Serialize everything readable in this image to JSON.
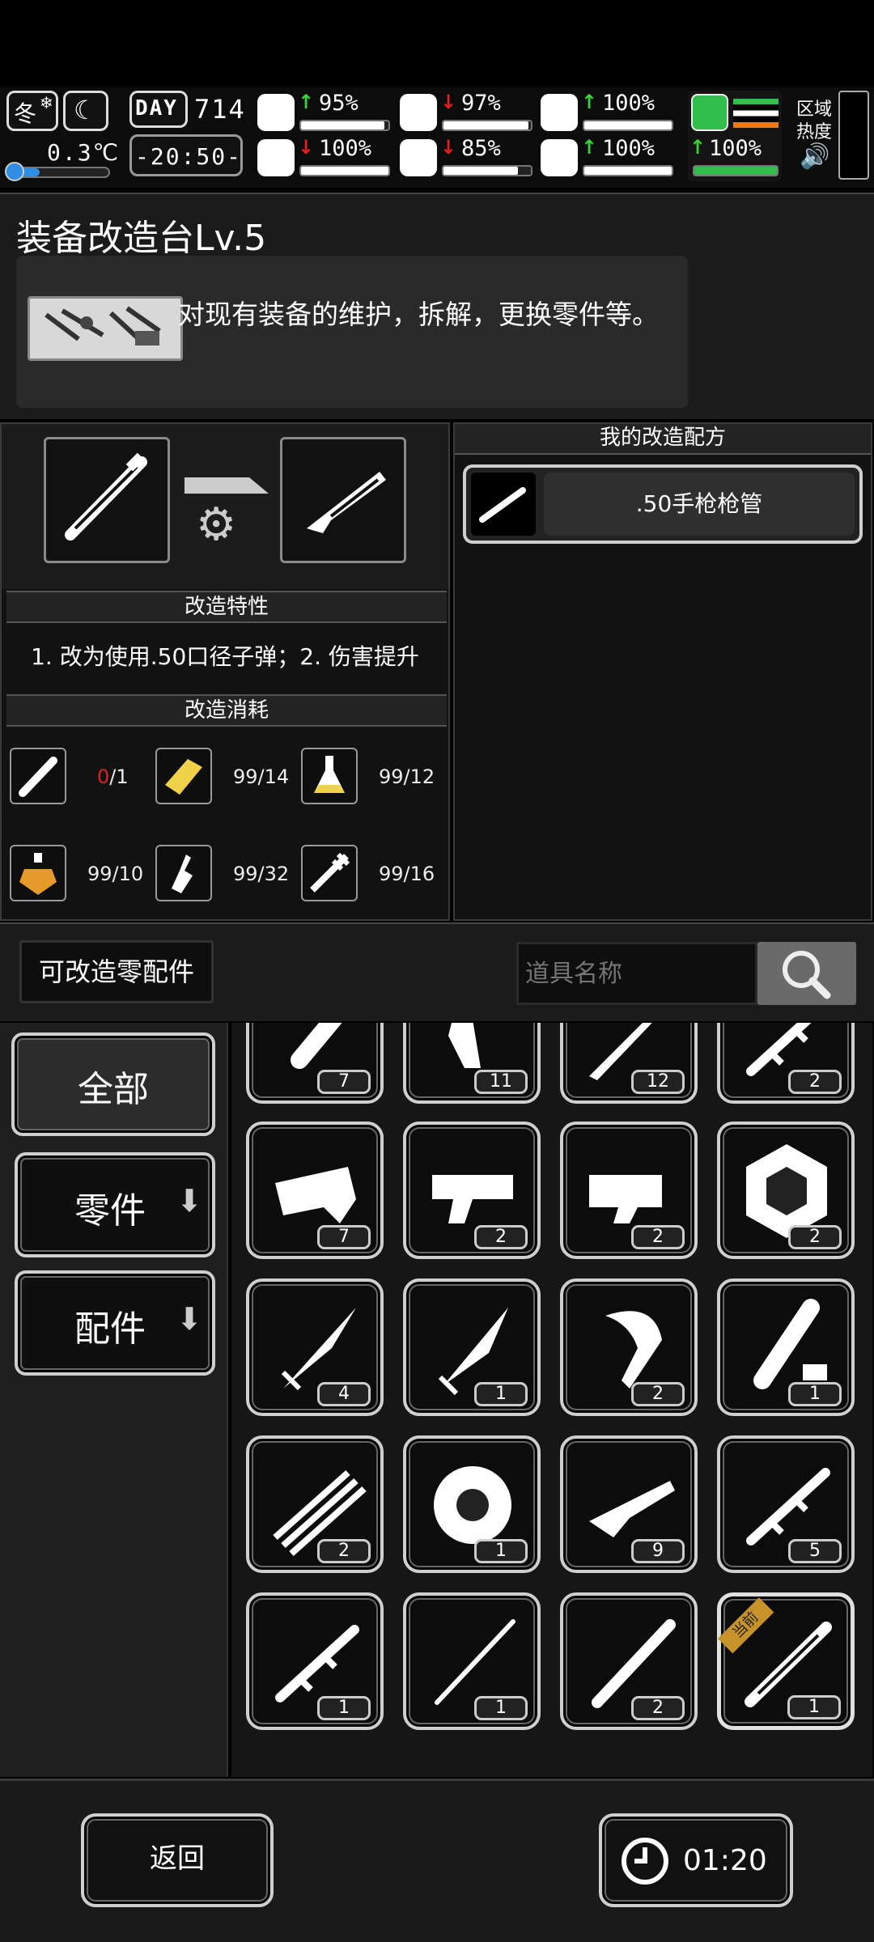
{
  "status": {
    "season": "冬",
    "temperature": "0.3℃",
    "day_label": "DAY",
    "day_number": "714",
    "clock": "-20:50-",
    "stats": [
      {
        "name": "health",
        "icon": "medkit-icon",
        "trend": "up",
        "value": "95%",
        "level": 0.95
      },
      {
        "name": "hunger",
        "icon": "stomach-icon",
        "trend": "down",
        "value": "97%",
        "level": 0.97
      },
      {
        "name": "stamina",
        "icon": "lung-icon",
        "trend": "up",
        "value": "100%",
        "level": 1.0
      },
      {
        "name": "mood",
        "icon": "brain-icon",
        "trend": "down",
        "value": "100%",
        "level": 1.0
      },
      {
        "name": "thirst",
        "icon": "water-drop-icon",
        "trend": "down",
        "value": "85%",
        "level": 0.85
      },
      {
        "name": "heart",
        "icon": "heart-icon",
        "trend": "up",
        "value": "100%",
        "level": 1.0
      }
    ],
    "boot_value": "100%",
    "zone_heat_label": "区域热度"
  },
  "station": {
    "title": "装备改造台Lv.5",
    "description": "对现有装备的维护，拆解，更换零件等。"
  },
  "mod": {
    "traits_header": "改造特性",
    "traits_text": "1. 改为使用.50口径子弹；2. 伤害提升",
    "cost_header": "改造消耗",
    "costs": [
      {
        "icon": "pipe-icon",
        "have": "0",
        "need": "/1",
        "lacking": true
      },
      {
        "icon": "gold-bar-icon",
        "value": "99/14"
      },
      {
        "icon": "flask-icon",
        "value": "99/12"
      },
      {
        "icon": "potion-icon",
        "value": "99/10"
      },
      {
        "icon": "oil-bottle-icon",
        "value": "99/32"
      },
      {
        "icon": "syringe-icon",
        "value": "99/16"
      }
    ]
  },
  "recipes": {
    "header": "我的改造配方",
    "items": [
      {
        "label": ".50手枪枪管"
      }
    ]
  },
  "parts": {
    "tab_label": "可改造零配件",
    "search_placeholder": "道具名称",
    "filters": [
      "全部",
      "零件",
      "配件"
    ],
    "grid": [
      {
        "icon": "grip-part-icon",
        "count": "7"
      },
      {
        "icon": "trigger-part-icon",
        "count": "11"
      },
      {
        "icon": "long-blade-part-icon",
        "count": "12"
      },
      {
        "icon": "barrel-part-icon",
        "count": "2"
      },
      {
        "icon": "receiver-part-icon",
        "count": "7"
      },
      {
        "icon": "pistol-frame-icon",
        "count": "2"
      },
      {
        "icon": "trigger-group-icon",
        "count": "2"
      },
      {
        "icon": "weight-plate-icon",
        "count": "2"
      },
      {
        "icon": "knife-icon",
        "count": "4"
      },
      {
        "icon": "dagger-icon",
        "count": "1"
      },
      {
        "icon": "machete-icon",
        "count": "2"
      },
      {
        "icon": "battery-icon",
        "count": "1"
      },
      {
        "icon": "gatling-barrel-icon",
        "count": "2"
      },
      {
        "icon": "saw-blade-icon",
        "count": "1"
      },
      {
        "icon": "rifle-part-icon",
        "count": "9"
      },
      {
        "icon": "barrel-part-icon",
        "count": "5"
      },
      {
        "icon": "barrel-part-icon",
        "count": "1"
      },
      {
        "icon": "rod-icon",
        "count": "1"
      },
      {
        "icon": "pipe-icon",
        "count": "2"
      },
      {
        "icon": "pistol-barrel-icon",
        "count": "1",
        "current": true
      }
    ],
    "current_tag": "当前"
  },
  "footer": {
    "back_label": "返回",
    "timer": "01:20"
  }
}
